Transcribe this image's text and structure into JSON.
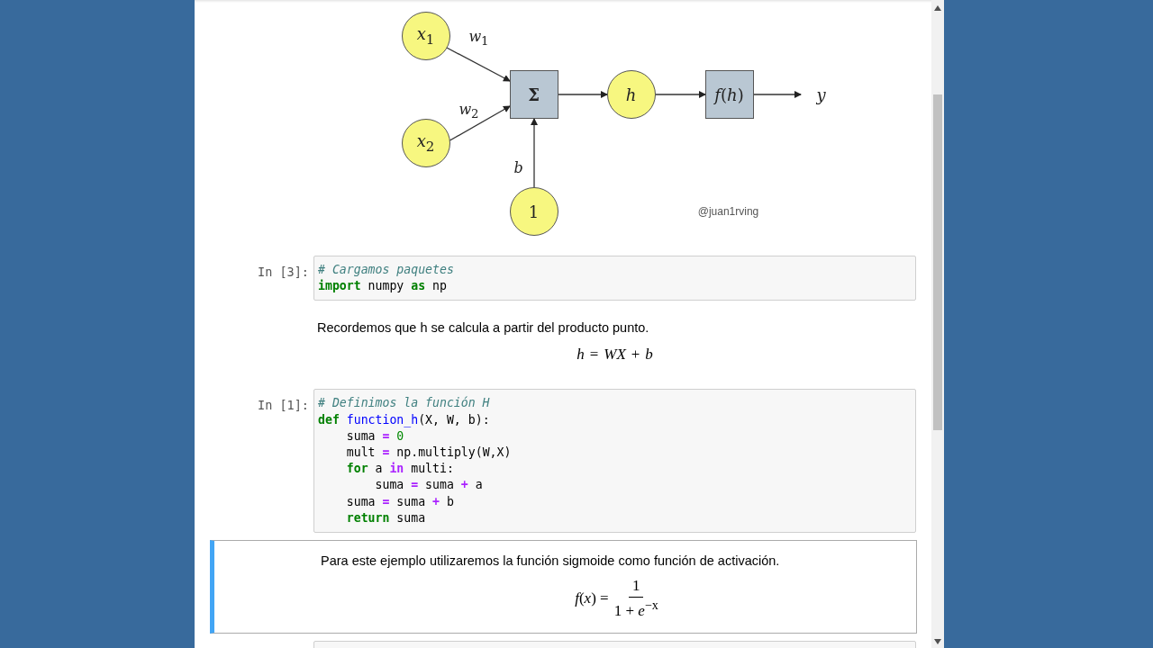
{
  "diagram": {
    "nodes": [
      {
        "label": "*x*$_{1}$",
        "kind": "circle"
      },
      {
        "label": "*x*$_{2}$",
        "kind": "circle"
      },
      {
        "label": "**Σ**",
        "kind": "box"
      },
      {
        "label": "*h*",
        "kind": "circle"
      },
      {
        "label": "*f*(*h*)",
        "kind": "box"
      },
      {
        "label": "1",
        "kind": "circle"
      }
    ],
    "edges": [
      {
        "label": "*w*$_{1}$"
      },
      {
        "label": "*w*$_{2}$"
      },
      {
        "label": "*b*"
      }
    ],
    "output": "*y*",
    "credit": "@juan1rving"
  },
  "cells": [
    {
      "kind": "code",
      "selected": false,
      "prompt": "In [3]:",
      "lines": [
        [
          {
            "kind": "comment",
            "t": "# Cargamos paquetes"
          }
        ],
        [
          {
            "kind": "kw",
            "t": "import"
          },
          {
            "kind": "text",
            "t": " numpy "
          },
          {
            "kind": "kw",
            "t": "as"
          },
          {
            "kind": "text",
            "t": " np"
          }
        ]
      ]
    },
    {
      "kind": "markdown",
      "selected": false,
      "text": "Recordemos que h se calcula a partir del producto punto.",
      "formula": {
        "kind": "inline",
        "text": "*h* = *WX* + *b*"
      }
    },
    {
      "kind": "code",
      "selected": false,
      "prompt": "In [1]:",
      "lines": [
        [
          {
            "kind": "comment",
            "t": "# Definimos la función H"
          }
        ],
        [
          {
            "kind": "kw",
            "t": "def"
          },
          {
            "kind": "fn",
            "t": " function_h"
          },
          {
            "kind": "text",
            "t": "(X, W, b):"
          }
        ],
        [
          {
            "kind": "text",
            "t": "    suma "
          },
          {
            "kind": "op",
            "t": "="
          },
          {
            "kind": "num",
            "t": " 0"
          }
        ],
        [
          {
            "kind": "text",
            "t": "    mult "
          },
          {
            "kind": "op",
            "t": "="
          },
          {
            "kind": "text",
            "t": " np.multiply(W,X)"
          }
        ],
        [
          {
            "kind": "kw",
            "t": "    for"
          },
          {
            "kind": "text",
            "t": " a "
          },
          {
            "kind": "op",
            "t": "in"
          },
          {
            "kind": "text",
            "t": " multi:"
          }
        ],
        [
          {
            "kind": "text",
            "t": "        suma "
          },
          {
            "kind": "op",
            "t": "="
          },
          {
            "kind": "text",
            "t": " suma "
          },
          {
            "kind": "op",
            "t": "+"
          },
          {
            "kind": "text",
            "t": " a"
          }
        ],
        [
          {
            "kind": "text",
            "t": "    suma "
          },
          {
            "kind": "op",
            "t": "="
          },
          {
            "kind": "text",
            "t": " suma "
          },
          {
            "kind": "op",
            "t": "+"
          },
          {
            "kind": "text",
            "t": " b"
          }
        ],
        [
          {
            "kind": "kw",
            "t": "    return"
          },
          {
            "kind": "text",
            "t": " suma"
          }
        ]
      ]
    },
    {
      "kind": "markdown",
      "selected": true,
      "text": "Para este ejemplo utilizaremos la función sigmoide como función de activación.",
      "formula": {
        "kind": "fraction",
        "lhs": "*f*(*x*) =",
        "numerator": "1",
        "denominator": "1 + *e*$^{−x}$"
      }
    },
    {
      "kind": "code",
      "selected": false
    }
  ]
}
